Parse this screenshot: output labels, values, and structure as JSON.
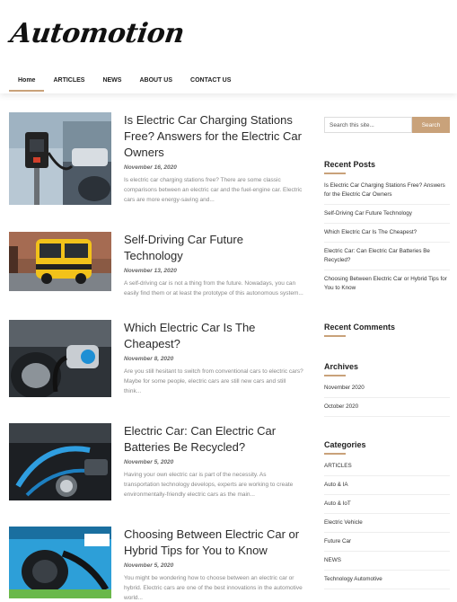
{
  "site": {
    "logo": "Automotion"
  },
  "nav": [
    {
      "label": "Home",
      "active": true
    },
    {
      "label": "ARTICLES"
    },
    {
      "label": "NEWS"
    },
    {
      "label": "ABOUT US"
    },
    {
      "label": "CONTACT US"
    }
  ],
  "posts": [
    {
      "title": "Is Electric Car Charging Stations Free? Answers for the Electric Car Owners",
      "date": "November 16, 2020",
      "excerpt": "Is electric car charging stations free? There are some classic comparisons between an electric car and the fuel-engine car. Electric cars are more energy-saving and..."
    },
    {
      "title": "Self-Driving Car Future Technology",
      "date": "November 13, 2020",
      "excerpt": "A self-driving car is not a thing from the future. Nowadays, you can easily find them or at least the prototype of this autonomous system..."
    },
    {
      "title": "Which Electric Car Is The Cheapest?",
      "date": "November 8, 2020",
      "excerpt": "Are you still hesitant to switch from conventional cars to electric cars? Maybe for some people, electric cars are still new cars and still think..."
    },
    {
      "title": "Electric Car: Can Electric Car Batteries Be Recycled?",
      "date": "November 5, 2020",
      "excerpt": "Having your own electric car is part of the necessity. As transportation technology develops, experts are working to create environmentally-friendly electric cars as the main..."
    },
    {
      "title": "Choosing Between Electric Car or Hybrid Tips for You to Know",
      "date": "November 5, 2020",
      "excerpt": "You might be wondering how to choose between an electric car or hybrid. Electric cars are one of the best innovations in the automotive world..."
    }
  ],
  "search": {
    "placeholder": "Search this site...",
    "button": "Search"
  },
  "recent_posts": {
    "title": "Recent Posts",
    "items": [
      "Is Electric Car Charging Stations Free? Answers for the Electric Car Owners",
      "Self-Driving Car Future Technology",
      "Which Electric Car Is The Cheapest?",
      "Electric Car: Can Electric Car Batteries Be Recycled?",
      "Choosing Between Electric Car or Hybrid Tips for You to Know"
    ]
  },
  "recent_comments": {
    "title": "Recent Comments"
  },
  "archives": {
    "title": "Archives",
    "items": [
      "November 2020",
      "October 2020"
    ]
  },
  "categories": {
    "title": "Categories",
    "items": [
      "ARTICLES",
      "Auto & IA",
      "Auto & IoT",
      "Electric Vehicle",
      "Future Car",
      "NEWS",
      "Technology Automotive"
    ]
  },
  "colors": {
    "accent": "#c9a27a"
  }
}
